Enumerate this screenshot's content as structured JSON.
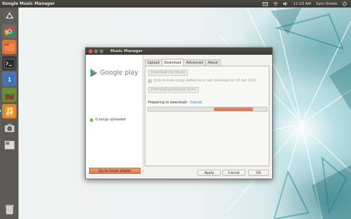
{
  "top_panel": {
    "app_title": "Google Music Manager",
    "time": "11:23 AM",
    "user": "Sam Steele"
  },
  "launcher": {
    "items": [
      {
        "name": "dash-home-icon"
      },
      {
        "name": "chromium-icon"
      },
      {
        "name": "file-manager-icon"
      },
      {
        "name": "terminal-icon"
      },
      {
        "name": "ubuntu-one-icon"
      },
      {
        "name": "minecraft-icon"
      },
      {
        "name": "music-manager-icon"
      },
      {
        "name": "camera-icon"
      },
      {
        "name": "workspace-switcher-icon"
      },
      {
        "name": "trash-icon"
      }
    ]
  },
  "window": {
    "title": "Music Manager",
    "brand": "Google play",
    "status": "0 songs uploaded",
    "go_to_player": "Go to music player",
    "tabs": [
      {
        "label": "Upload",
        "active": false
      },
      {
        "label": "Download",
        "active": true
      },
      {
        "label": "Advanced",
        "active": false
      },
      {
        "label": "About",
        "active": false
      }
    ],
    "download": {
      "download_library": "Download my library",
      "only_new": "Only include songs added since last download on 26 Apr 2012",
      "download_purchased": "Download purchased music",
      "preparing": "Preparing to download - ",
      "cancel_link": "Cancel"
    },
    "buttons": {
      "apply": "Apply",
      "cancel": "Cancel",
      "ok": "OK"
    }
  },
  "colors": {
    "accent": "#e8774a",
    "status_green": "#6fbf3a",
    "link": "#2a6fc4"
  }
}
